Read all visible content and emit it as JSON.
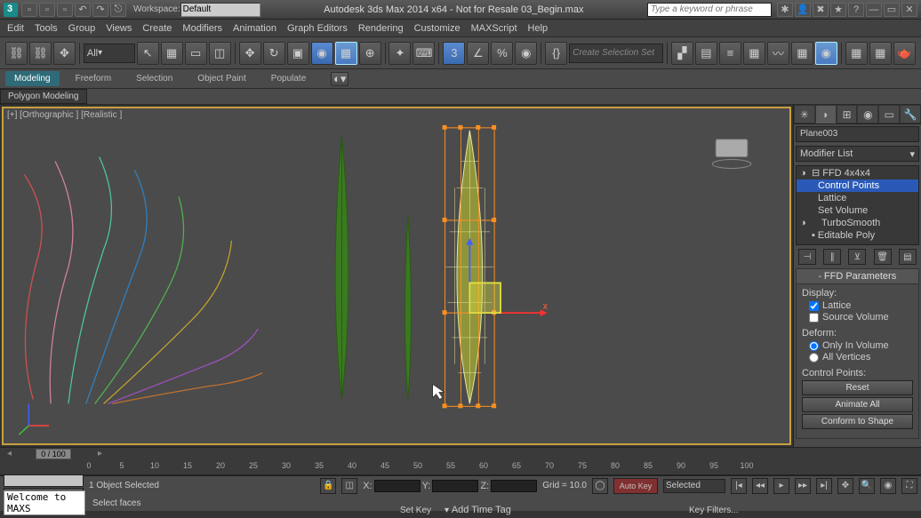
{
  "titlebar": {
    "workspace_label": "Workspace:",
    "workspace_value": "Default",
    "title": "Autodesk 3ds Max 2014 x64 - Not for Resale   03_Begin.max",
    "search_placeholder": "Type a keyword or phrase"
  },
  "menu": [
    "Edit",
    "Tools",
    "Group",
    "Views",
    "Create",
    "Modifiers",
    "Animation",
    "Graph Editors",
    "Rendering",
    "Customize",
    "MAXScript",
    "Help"
  ],
  "toolbar": {
    "filter": "All",
    "selset_placeholder": "Create Selection Set"
  },
  "ribbon": {
    "tabs": [
      "Modeling",
      "Freeform",
      "Selection",
      "Object Paint",
      "Populate"
    ],
    "subtab": "Polygon Modeling"
  },
  "viewport": {
    "label": "[+] [Orthographic ] [Realistic ]",
    "gizmo_x": "x"
  },
  "cmd": {
    "objname": "Plane003",
    "modlist": "Modifier List",
    "stack": [
      {
        "label": "FFD 4x4x4",
        "icon": "◑",
        "expand": "⊟"
      },
      {
        "label": "Control Points",
        "sub": true,
        "sel": true
      },
      {
        "label": "Lattice",
        "sub": true
      },
      {
        "label": "Set Volume",
        "sub": true
      },
      {
        "label": "TurboSmooth",
        "icon": "◑"
      },
      {
        "label": "Editable Poly",
        "expand": "▪"
      }
    ],
    "rollout": {
      "title": "FFD Parameters",
      "display_label": "Display:",
      "lattice": "Lattice",
      "source_vol": "Source Volume",
      "deform_label": "Deform:",
      "only_in": "Only In Volume",
      "all_verts": "All Vertices",
      "cp_label": "Control Points:",
      "reset": "Reset",
      "animate": "Animate All",
      "conform": "Conform to Shape"
    }
  },
  "timeline": {
    "pos": "0 / 100",
    "ticks": [
      0,
      5,
      10,
      15,
      20,
      25,
      30,
      35,
      40,
      45,
      50,
      55,
      60,
      65,
      70,
      75,
      80,
      85,
      90,
      95,
      100
    ]
  },
  "status": {
    "sel": "1 Object Selected",
    "x": "X:",
    "y": "Y:",
    "z": "Z:",
    "grid": "Grid = 10.0",
    "autokey": "Auto Key",
    "setkey": "Set Key",
    "selected": "Selected",
    "keyfilt": "Key Filters...",
    "welcome": "Welcome to MAXS",
    "selectfaces": "Select faces",
    "addtag": "Add Time Tag"
  }
}
